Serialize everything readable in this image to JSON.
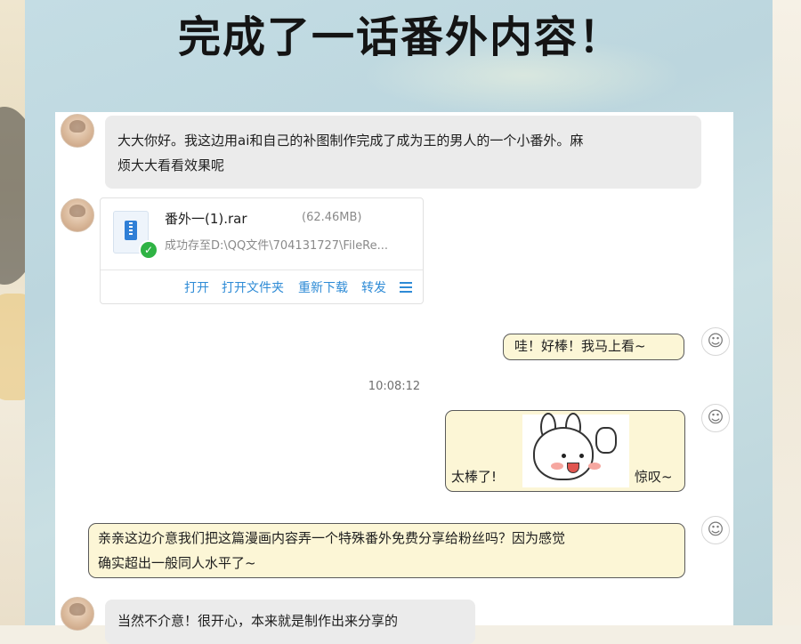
{
  "headline": "完成了一话番外内容！",
  "messages": {
    "m1": {
      "line1": "大大你好。我这边用ai和自己的补图制作完成了成为王的男人的一个小番外。麻",
      "line2": "烦大大看看效果呢"
    },
    "file": {
      "name": "番外一(1).rar",
      "size": "(62.46MB)",
      "path": "成功存至D:\\QQ文件\\704131727\\FileRe...",
      "actions": {
        "open": "打开",
        "open_folder": "打开文件夹",
        "redownload": "重新下载",
        "forward": "转发"
      }
    },
    "reply1": "哇！好棒！我马上看~",
    "timestamp": "10:08:12",
    "sticker": {
      "left_text": "太棒了!",
      "right_text": "惊叹~"
    },
    "reply2": {
      "line1": "亲亲这边介意我们把这篇漫画内容弄一个特殊番外免费分享给粉丝吗？因为感觉",
      "line2": "确实超出一般同人水平了~"
    },
    "m_last": "当然不介意！很开心，本来就是制作出来分享的"
  },
  "colors": {
    "panel_bg": "#c4dde4",
    "chat_bg": "#ffffff",
    "other_bubble": "#ebebeb",
    "my_bubble": "#fcf6d6",
    "link": "#2e8bd6",
    "success": "#2fb344"
  },
  "icons": {
    "file_type": "zip-archive-icon",
    "status": "check-circle-icon",
    "menu": "hamburger-menu-icon"
  }
}
